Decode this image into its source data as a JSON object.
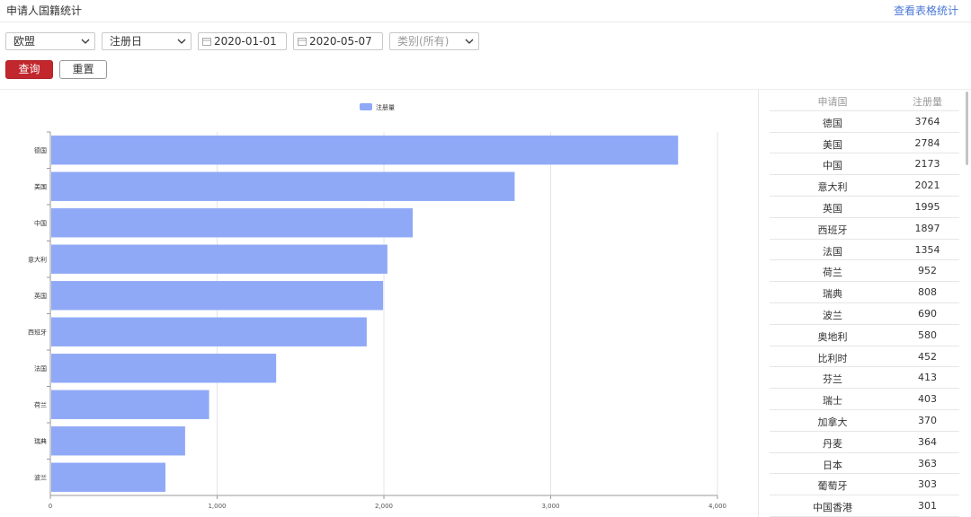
{
  "header": {
    "title": "申请人国籍统计",
    "link": "查看表格统计"
  },
  "filters": {
    "region": "欧盟",
    "date_type": "注册日",
    "start_date": "2020-01-01",
    "end_date": "2020-05-07",
    "category_placeholder": "类别(所有)"
  },
  "buttons": {
    "query": "查询",
    "reset": "重置"
  },
  "chart_data": {
    "type": "bar",
    "orientation": "horizontal",
    "legend_position": "top",
    "categories": [
      "德国",
      "美国",
      "中国",
      "意大利",
      "英国",
      "西班牙",
      "法国",
      "荷兰",
      "瑞典",
      "波兰"
    ],
    "series": [
      {
        "name": "注册量",
        "color": "#90a9f7",
        "values": [
          3764,
          2784,
          2173,
          2021,
          1995,
          1897,
          1354,
          952,
          808,
          690
        ]
      }
    ],
    "x_ticks": [
      "0",
      "1,000",
      "2,000",
      "3,000",
      "4,000"
    ],
    "xlim": [
      0,
      4000
    ],
    "grid": true
  },
  "table": {
    "columns": [
      "申请国",
      "注册量"
    ],
    "rows": [
      [
        "德国",
        "3764"
      ],
      [
        "美国",
        "2784"
      ],
      [
        "中国",
        "2173"
      ],
      [
        "意大利",
        "2021"
      ],
      [
        "英国",
        "1995"
      ],
      [
        "西班牙",
        "1897"
      ],
      [
        "法国",
        "1354"
      ],
      [
        "荷兰",
        "952"
      ],
      [
        "瑞典",
        "808"
      ],
      [
        "波兰",
        "690"
      ],
      [
        "奥地利",
        "580"
      ],
      [
        "比利时",
        "452"
      ],
      [
        "芬兰",
        "413"
      ],
      [
        "瑞士",
        "403"
      ],
      [
        "加拿大",
        "370"
      ],
      [
        "丹麦",
        "364"
      ],
      [
        "日本",
        "363"
      ],
      [
        "葡萄牙",
        "303"
      ],
      [
        "中国香港",
        "301"
      ]
    ]
  },
  "colors": {
    "accent": "#c1272d",
    "bar": "#90a9f7",
    "link": "#4a78d6"
  }
}
